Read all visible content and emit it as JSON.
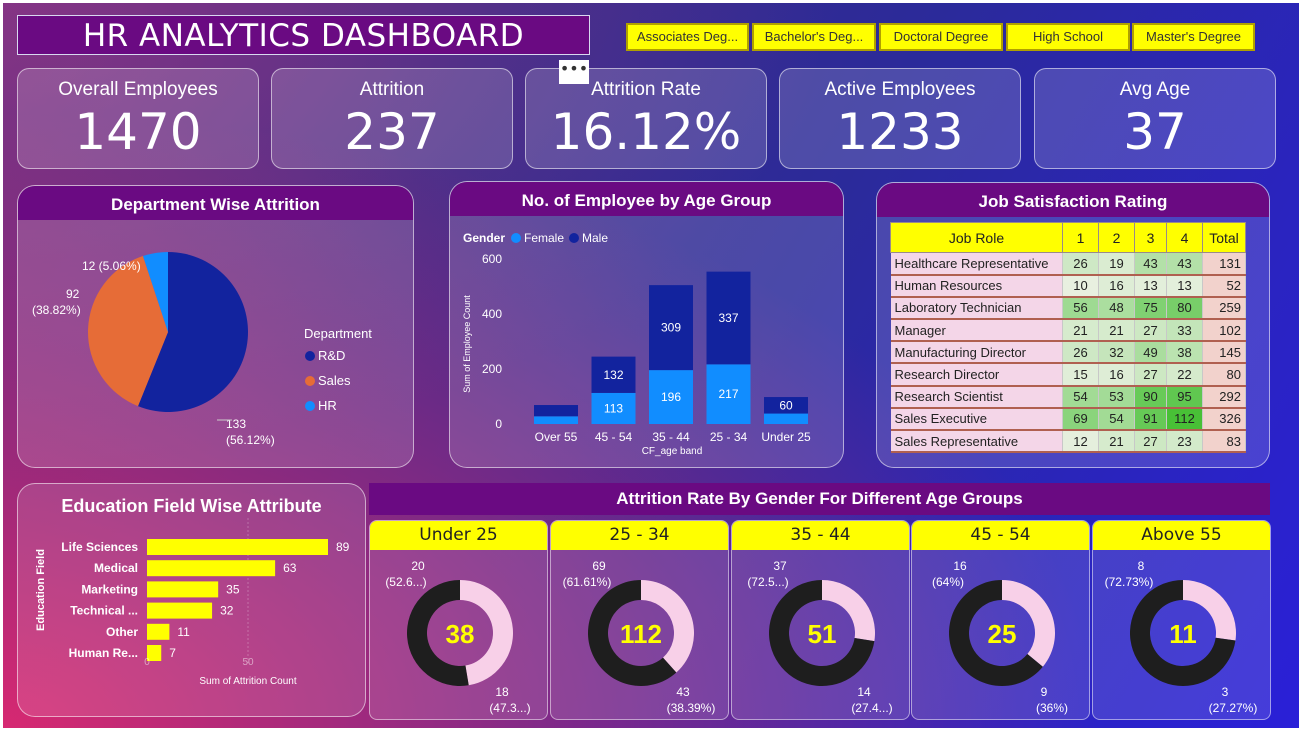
{
  "header": {
    "title": "HR ANALYTICS DASHBOARD",
    "menu_dots": "•••"
  },
  "slicers": [
    "Associates Deg...",
    "Bachelor's Deg...",
    "Doctoral Degree",
    "High School",
    "Master's Degree"
  ],
  "kpis": [
    {
      "label": "Overall Employees",
      "value": "1470"
    },
    {
      "label": "Attrition",
      "value": "237"
    },
    {
      "label": "Attrition Rate",
      "value": "16.12%"
    },
    {
      "label": "Active Employees",
      "value": "1233"
    },
    {
      "label": "Avg Age",
      "value": "37"
    }
  ],
  "colors": {
    "rd": "#12239e",
    "sales": "#e66c37",
    "hr": "#118dff",
    "female": "#118dff",
    "male": "#12239e",
    "yellow": "#ffff00",
    "donut_dark": "#1e1e1e",
    "donut_light": "#f8d0e8",
    "donut_value": "#ffff00"
  },
  "chart_data": [
    {
      "type": "pie",
      "title": "Department Wise Attrition",
      "legend_title": "Department",
      "legend_position": "right",
      "slices": [
        {
          "name": "R&D",
          "value": 133,
          "label_value": "133",
          "label_pct": "(56.12%)"
        },
        {
          "name": "Sales",
          "value": 92,
          "label_value": "92",
          "label_pct": "(38.82%)"
        },
        {
          "name": "HR",
          "value": 12,
          "label_value": "12 (5.06%)",
          "label_pct": ""
        }
      ]
    },
    {
      "type": "bar",
      "stacked": true,
      "title": "No. of Employee by Age Group",
      "legend_title": "Gender",
      "legend_position": "top-left",
      "xlabel": "CF_age band",
      "ylabel": "Sum of Employee Count",
      "ylim": [
        0,
        600
      ],
      "yticks": [
        0,
        200,
        400,
        600
      ],
      "categories": [
        "Over 55",
        "45 - 54",
        "35 - 44",
        "25 - 34",
        "Under 25"
      ],
      "series": [
        {
          "name": "Female",
          "values": [
            28,
            113,
            196,
            217,
            38
          ],
          "labels": [
            "",
            "113",
            "196",
            "217",
            ""
          ]
        },
        {
          "name": "Male",
          "values": [
            41,
            132,
            309,
            337,
            60
          ],
          "labels": [
            "",
            "132",
            "309",
            "337",
            "60"
          ]
        }
      ]
    },
    {
      "type": "table",
      "title": "Job Satisfaction Rating",
      "columns": [
        "Job Role",
        "1",
        "2",
        "3",
        "4",
        "Total"
      ],
      "rows": [
        [
          "Healthcare Representative",
          "26",
          "19",
          "43",
          "43",
          "131"
        ],
        [
          "Human Resources",
          "10",
          "16",
          "13",
          "13",
          "52"
        ],
        [
          "Laboratory Technician",
          "56",
          "48",
          "75",
          "80",
          "259"
        ],
        [
          "Manager",
          "21",
          "21",
          "27",
          "33",
          "102"
        ],
        [
          "Manufacturing Director",
          "26",
          "32",
          "49",
          "38",
          "145"
        ],
        [
          "Research Director",
          "15",
          "16",
          "27",
          "22",
          "80"
        ],
        [
          "Research Scientist",
          "54",
          "53",
          "90",
          "95",
          "292"
        ],
        [
          "Sales Executive",
          "69",
          "54",
          "91",
          "112",
          "326"
        ],
        [
          "Sales Representative",
          "12",
          "21",
          "27",
          "23",
          "83"
        ]
      ]
    },
    {
      "type": "bar",
      "orientation": "horizontal",
      "title": "Education Field Wise Attribute",
      "xlabel": "Sum of Attrition Count",
      "ylabel": "Education Field",
      "xlim": [
        0,
        100
      ],
      "xticks": [
        "0",
        "50"
      ],
      "categories": [
        "Life Sciences",
        "Medical",
        "Marketing",
        "Technical ...",
        "Other",
        "Human Re..."
      ],
      "values": [
        89,
        63,
        35,
        32,
        11,
        7
      ]
    },
    {
      "type": "pie",
      "donut": true,
      "title": "Attrition Rate By Gender For Different Age Groups",
      "groups": [
        {
          "name": "Under 25",
          "total": "38",
          "dark": 20,
          "light": 18,
          "dark_label": "20",
          "dark_pct": "(52.6...)",
          "light_label": "18",
          "light_pct": "(47.3...)"
        },
        {
          "name": "25 - 34",
          "total": "112",
          "dark": 69,
          "light": 43,
          "dark_label": "69",
          "dark_pct": "(61.61%)",
          "light_label": "43",
          "light_pct": "(38.39%)"
        },
        {
          "name": "35 - 44",
          "total": "51",
          "dark": 37,
          "light": 14,
          "dark_label": "37",
          "dark_pct": "(72.5...)",
          "light_label": "14",
          "light_pct": "(27.4...)"
        },
        {
          "name": "45 - 54",
          "total": "25",
          "dark": 16,
          "light": 9,
          "dark_label": "16",
          "dark_pct": "(64%)",
          "light_label": "9",
          "light_pct": "(36%)"
        },
        {
          "name": "Above 55",
          "total": "11",
          "dark": 8,
          "light": 3,
          "dark_label": "8",
          "dark_pct": "(72.73%)",
          "light_label": "3",
          "light_pct": "(27.27%)"
        }
      ]
    }
  ]
}
